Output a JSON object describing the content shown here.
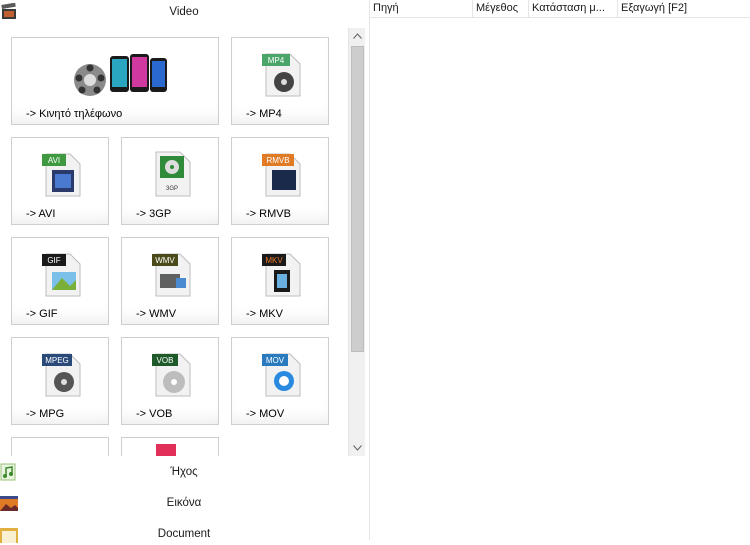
{
  "categories": {
    "video": "Video",
    "audio": "Ήχος",
    "image": "Εικόνα",
    "document": "Document"
  },
  "tiles": [
    {
      "label": "-> Κινητό τηλέφωνο",
      "badge": "",
      "badge_color": "#000000"
    },
    {
      "label": "-> MP4",
      "badge": "MP4",
      "badge_color": "#4aa56a"
    },
    {
      "label": "-> AVI",
      "badge": "AVI",
      "badge_color": "#3f9a3f"
    },
    {
      "label": "-> 3GP",
      "badge": "3GP",
      "badge_color": "#2f8a3a"
    },
    {
      "label": "-> RMVB",
      "badge": "RMVB",
      "badge_color": "#e07a25"
    },
    {
      "label": "-> GIF",
      "badge": "GIF",
      "badge_color": "#1a1a1a"
    },
    {
      "label": "-> WMV",
      "badge": "WMV",
      "badge_color": "#4a4a1a"
    },
    {
      "label": "-> MKV",
      "badge": "MKV",
      "badge_color": "#e87a2a"
    },
    {
      "label": "-> MPG",
      "badge": "MPEG",
      "badge_color": "#2a4a7a"
    },
    {
      "label": "-> VOB",
      "badge": "VOB",
      "badge_color": "#1f5a2a"
    },
    {
      "label": "-> MOV",
      "badge": "MOV",
      "badge_color": "#2a7ac0"
    }
  ],
  "columns": [
    "Πηγή",
    "Μέγεθος",
    "Κατάσταση μ...",
    "Εξαγωγή [F2]"
  ]
}
